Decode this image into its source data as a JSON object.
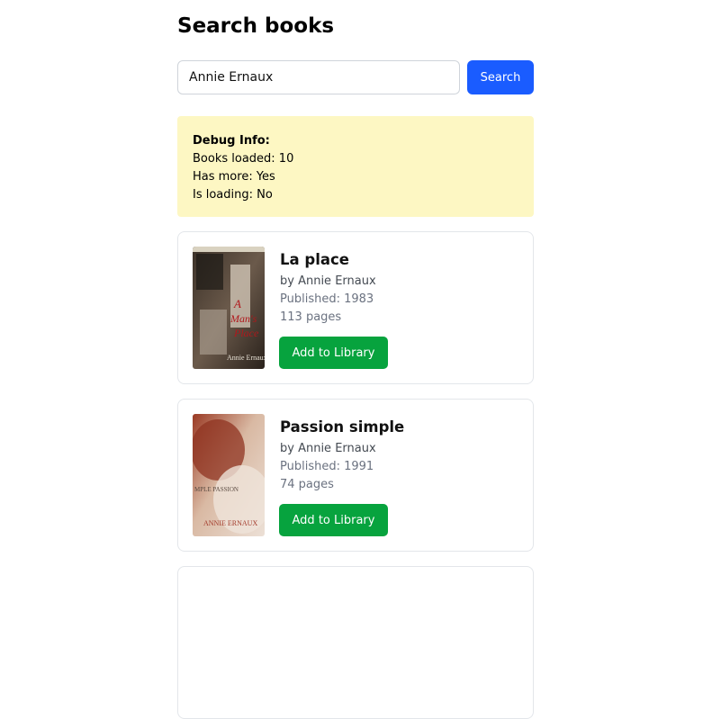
{
  "header": {
    "title": "Search books"
  },
  "search": {
    "value": "Annie Ernaux",
    "button_label": "Search"
  },
  "debug": {
    "title": "Debug Info:",
    "books_loaded": "Books loaded: 10",
    "has_more": "Has more: Yes",
    "is_loading": "Is loading: No"
  },
  "books": [
    {
      "title": "La place",
      "author": "by Annie Ernaux",
      "published": "Published: 1983",
      "pages": "113 pages",
      "button_label": "Add to Library",
      "cover_text": "A Man's Place"
    },
    {
      "title": "Passion simple",
      "author": "by Annie Ernaux",
      "published": "Published: 1991",
      "pages": "74 pages",
      "button_label": "Add to Library",
      "cover_text": "SIMPLE PASSION"
    }
  ],
  "colors": {
    "primary": "#1a5cff",
    "success": "#07a33e",
    "debug_bg": "#fdf7c3"
  }
}
